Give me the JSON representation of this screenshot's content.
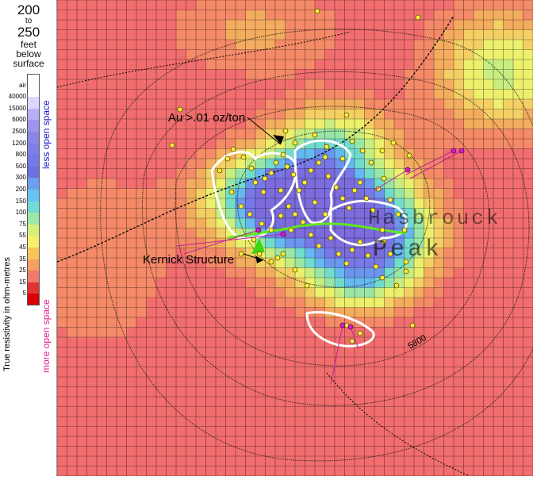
{
  "legend": {
    "depth_top": "200",
    "depth_to": "to",
    "depth_bottom": "250",
    "depth_unit": "feet",
    "depth_below": "below",
    "depth_surface": "surface",
    "scale_labels": [
      "air",
      "40000",
      "15000",
      "6000",
      "2500",
      "1200",
      "800",
      "500",
      "300",
      "200",
      "150",
      "100",
      "75",
      "55",
      "45",
      "35",
      "25",
      "15",
      "5"
    ],
    "scale_colors": [
      "#ffffff",
      "#ffffff",
      "#dcd6ff",
      "#b8b0f4",
      "#9c94ee",
      "#8a86e8",
      "#7e7ee6",
      "#7478e8",
      "#6c70e0",
      "#6aa0ee",
      "#66c2f0",
      "#6fdcd8",
      "#9ce8a8",
      "#d6f07a",
      "#f4f06c",
      "#f8c458",
      "#f4a060",
      "#f07a6a",
      "#e03434",
      "#d80000"
    ],
    "axis_title": "True resistivity in ohm-metres",
    "less_open": "less open space",
    "more_open": "more open space",
    "less_color": "#1a1ad0",
    "more_color": "#e0208c"
  },
  "map": {
    "label_au": "Au >.01 oz/ton",
    "label_kernick": "Kernick Structure",
    "label_peak": "Peak",
    "label_hasbrouck": "Hasbrouck",
    "label_contour": "5800"
  }
}
